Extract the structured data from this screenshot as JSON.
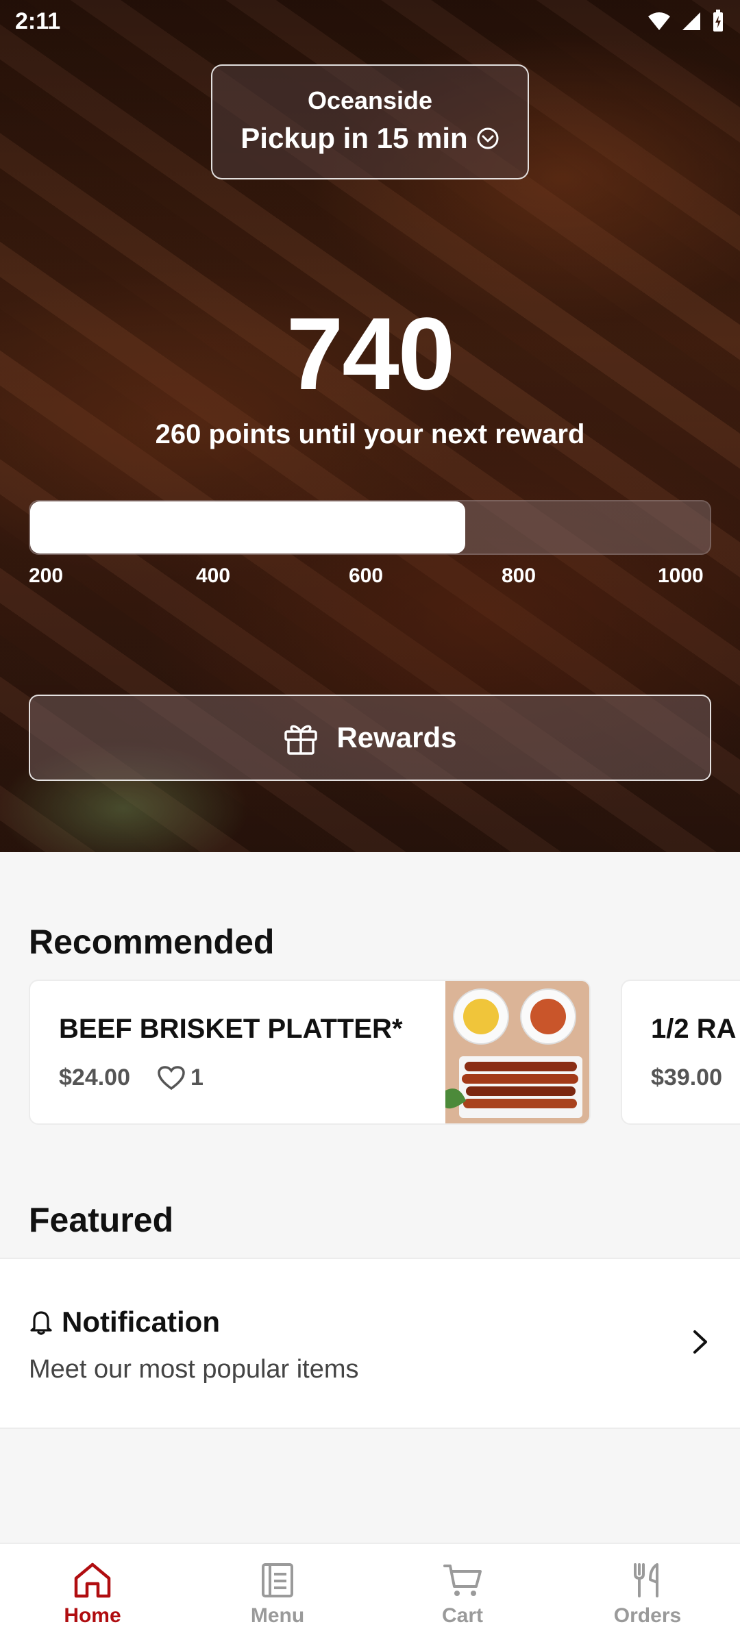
{
  "status_bar": {
    "time": "2:11"
  },
  "location": {
    "name": "Oceanside",
    "pickup": "Pickup in 15 min"
  },
  "points": {
    "value": "740",
    "caption": "260 points until your next reward",
    "progress_fraction": 0.64,
    "ticks": [
      "200",
      "400",
      "600",
      "800",
      "1000"
    ]
  },
  "rewards_button": {
    "label": "Rewards"
  },
  "recommended": {
    "title": "Recommended",
    "items": [
      {
        "name": "BEEF BRISKET PLATTER*",
        "price": "$24.00",
        "likes": "1"
      },
      {
        "name": "1/2 RA",
        "price": "$39.00"
      }
    ]
  },
  "featured": {
    "title": "Featured",
    "notification": {
      "title": "Notification",
      "subtitle": "Meet our most popular items"
    }
  },
  "nav": {
    "items": [
      {
        "label": "Home",
        "icon": "home-icon",
        "active": true
      },
      {
        "label": "Menu",
        "icon": "menu-list-icon",
        "active": false
      },
      {
        "label": "Cart",
        "icon": "cart-icon",
        "active": false
      },
      {
        "label": "Orders",
        "icon": "fork-knife-icon",
        "active": false
      }
    ]
  },
  "colors": {
    "accent": "#b00d10",
    "inactive": "#9a9a9a"
  }
}
